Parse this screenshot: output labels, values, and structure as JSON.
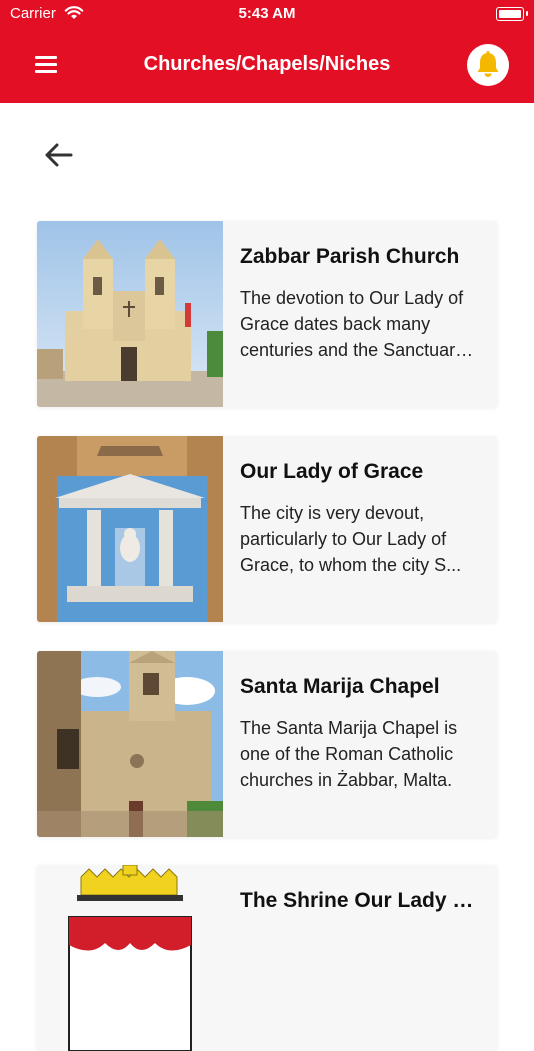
{
  "status_bar": {
    "carrier": "Carrier",
    "time": "5:43 AM"
  },
  "header": {
    "title": "Churches/Chapels/Niches",
    "bg_color": "#e30f24",
    "menu_icon": "hamburger-icon",
    "bell_icon": "bell-icon",
    "bell_color": "#f5b800"
  },
  "navigation": {
    "back_icon": "arrow-left-icon"
  },
  "cards": [
    {
      "title": "Zabbar Parish Church",
      "description": "The devotion to Our Lady of Grace dates back many centuries and the Sanctuary of Our Lady of Grace..."
    },
    {
      "title": "Our Lady of Grace",
      "description": "The city is very devout, particularly to Our Lady of Grace, to whom the city S..."
    },
    {
      "title": "Santa Marija Chapel",
      "description": "The Santa Marija Chapel is one of the Roman Catholic churches in Żabbar, Malta."
    },
    {
      "title": "The Shrine Our Lady of Grace",
      "description": ""
    }
  ]
}
